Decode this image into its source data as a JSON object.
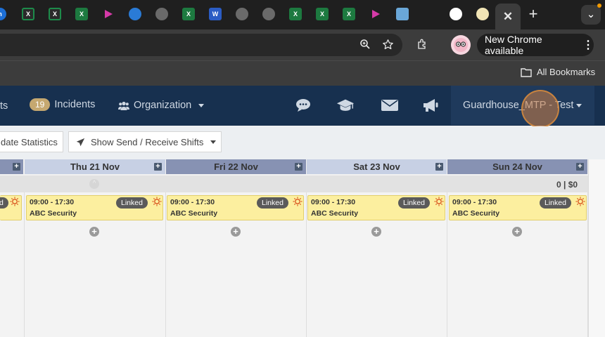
{
  "browser": {
    "tabs": [
      {
        "icon": "site-favicon",
        "label": "n",
        "color": "#1d6fd6"
      },
      {
        "icon": "excel-icon",
        "label": "X",
        "color": "#1d8b4a"
      },
      {
        "icon": "excel-icon",
        "label": "X",
        "color": "#1d8b4a"
      },
      {
        "icon": "excel-icon",
        "label": "X",
        "color": "#1d7a40"
      },
      {
        "icon": "play-icon",
        "label": "",
        "color": "#d63aa8"
      },
      {
        "icon": "cloud-icon",
        "label": "",
        "color": "#2a7bd6"
      },
      {
        "icon": "globe-icon",
        "label": "",
        "color": "#9a9a9a"
      },
      {
        "icon": "excel-icon",
        "label": "X",
        "color": "#1d7a40"
      },
      {
        "icon": "word-icon",
        "label": "W",
        "color": "#2b5cc4"
      },
      {
        "icon": "globe-icon",
        "label": "",
        "color": "#9a9a9a"
      },
      {
        "icon": "globe-icon",
        "label": "",
        "color": "#9a9a9a"
      },
      {
        "icon": "excel-icon",
        "label": "X",
        "color": "#1d7a40"
      },
      {
        "icon": "excel-icon",
        "label": "X",
        "color": "#1d7a40"
      },
      {
        "icon": "excel-icon",
        "label": "X",
        "color": "#1d7a40"
      },
      {
        "icon": "play-icon",
        "label": "",
        "color": "#d63aa8"
      },
      {
        "icon": "guardhouse-icon",
        "label": "",
        "color": "#6aa7d8"
      },
      {
        "icon": "hubspot-icon",
        "label": "",
        "color": "#ff7a59"
      },
      {
        "icon": "openai-icon",
        "label": "",
        "color": "#ffffff"
      },
      {
        "icon": "avatar-icon",
        "label": "",
        "color": "#f1e4b5"
      }
    ],
    "active_tab_close": "✕",
    "new_tab": "+",
    "tab_menu": "⌄",
    "new_chrome_label": "New Chrome available",
    "menu_dots": "⋮",
    "bookmarks_label": "All Bookmarks"
  },
  "nav": {
    "partial_left": "ts",
    "incidents_count": "19",
    "incidents_label": "Incidents",
    "organization_label": "Organization",
    "account_label": "Guardhouse_MTP - Test"
  },
  "actions": {
    "statistics_label": "date Statistics",
    "send_receive_label": "Show Send / Receive Shifts"
  },
  "calendar": {
    "stat_value": "0 | $0",
    "days": [
      {
        "label": "Thu 21 Nov"
      },
      {
        "label": "Fri 22 Nov"
      },
      {
        "label": "Sat 23 Nov"
      },
      {
        "label": "Sun 24 Nov"
      }
    ],
    "shift": {
      "time": "09:00 - 17:30",
      "site": "ABC Security",
      "tag": "Linked"
    },
    "partial_tag": "d"
  },
  "colors": {
    "nav_bg": "#17304f",
    "header_thu": "#c7d0e4",
    "header_fri": "#8792b3",
    "header_sat": "#c7d0e4",
    "header_sun": "#8792b3",
    "shift_bg": "#fcef9f",
    "badge": "#c5a870"
  }
}
